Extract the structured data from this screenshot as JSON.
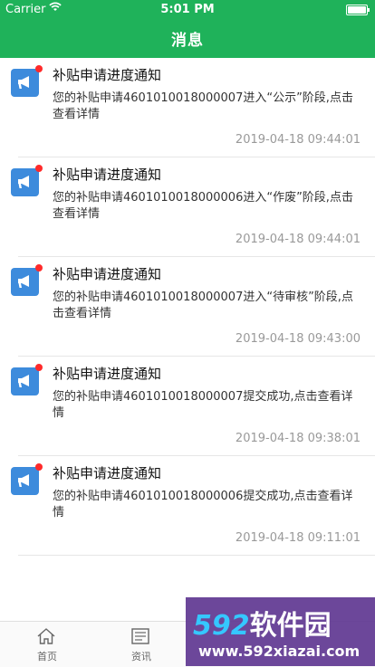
{
  "status_bar": {
    "carrier": "Carrier",
    "time": "5:01 PM"
  },
  "nav": {
    "title": "消息"
  },
  "notifications": [
    {
      "title": "补贴申请进度通知",
      "body": "您的补贴申请4601010018000007进入“公示”阶段,点击查看详情",
      "time": "2019-04-18 09:44:01"
    },
    {
      "title": "补贴申请进度通知",
      "body": "您的补贴申请4601010018000006进入“作废”阶段,点击查看详情",
      "time": "2019-04-18 09:44:01"
    },
    {
      "title": "补贴申请进度通知",
      "body": "您的补贴申请4601010018000007进入“待审核”阶段,点击查看详情",
      "time": "2019-04-18 09:43:00"
    },
    {
      "title": "补贴申请进度通知",
      "body": "您的补贴申请4601010018000007提交成功,点击查看详情",
      "time": "2019-04-18 09:38:01"
    },
    {
      "title": "补贴申请进度通知",
      "body": "您的补贴申请4601010018000006提交成功,点击查看详情",
      "time": "2019-04-18 09:11:01"
    }
  ],
  "tabbar": {
    "items": [
      {
        "label": "首页",
        "icon": "home-icon"
      },
      {
        "label": "资讯",
        "icon": "news-icon"
      }
    ]
  },
  "watermark": {
    "brand_num": "592",
    "brand_text": "软件园",
    "url": "www.592xiazai.com"
  },
  "colors": {
    "header_green": "#1fb25a",
    "icon_blue": "#3d8bdc",
    "unread_red": "#ff2a2a"
  }
}
